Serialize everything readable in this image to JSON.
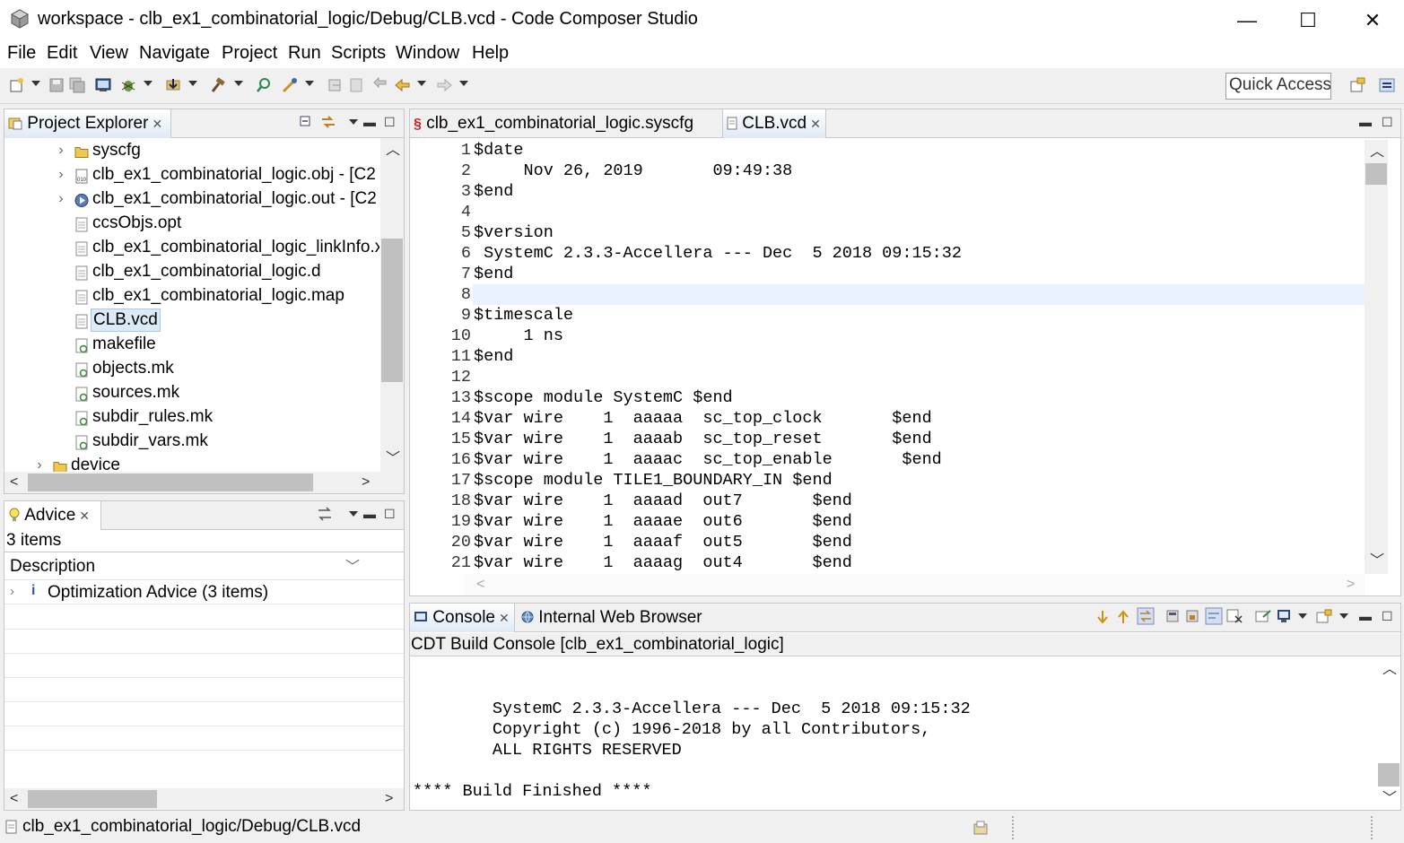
{
  "window": {
    "title": "workspace - clb_ex1_combinatorial_logic/Debug/CLB.vcd - Code Composer Studio",
    "minimize": "—",
    "maximize": "☐",
    "close": "✕"
  },
  "menu": [
    "File",
    "Edit",
    "View",
    "Navigate",
    "Project",
    "Run",
    "Scripts",
    "Window",
    "Help"
  ],
  "toolbar": {
    "quick_access_placeholder": "Quick Access"
  },
  "project_explorer": {
    "title": "Project Explorer",
    "items": [
      {
        "label": "syscfg",
        "type": "folder",
        "expandable": true,
        "indent": 1
      },
      {
        "label": "clb_ex1_combinatorial_logic.obj - [C2",
        "type": "obj",
        "expandable": true,
        "indent": 1
      },
      {
        "label": "clb_ex1_combinatorial_logic.out - [C2",
        "type": "out",
        "expandable": true,
        "indent": 1
      },
      {
        "label": "ccsObjs.opt",
        "type": "file",
        "expandable": false,
        "indent": 1
      },
      {
        "label": "clb_ex1_combinatorial_logic_linkInfo.x",
        "type": "file",
        "expandable": false,
        "indent": 1
      },
      {
        "label": "clb_ex1_combinatorial_logic.d",
        "type": "file",
        "expandable": false,
        "indent": 1
      },
      {
        "label": "clb_ex1_combinatorial_logic.map",
        "type": "file",
        "expandable": false,
        "indent": 1
      },
      {
        "label": "CLB.vcd",
        "type": "file",
        "expandable": false,
        "indent": 1,
        "selected": true
      },
      {
        "label": "makefile",
        "type": "mk",
        "expandable": false,
        "indent": 1
      },
      {
        "label": "objects.mk",
        "type": "mk",
        "expandable": false,
        "indent": 1
      },
      {
        "label": "sources.mk",
        "type": "mk",
        "expandable": false,
        "indent": 1
      },
      {
        "label": "subdir_rules.mk",
        "type": "mk",
        "expandable": false,
        "indent": 1
      },
      {
        "label": "subdir_vars.mk",
        "type": "mk",
        "expandable": false,
        "indent": 1
      },
      {
        "label": "device",
        "type": "folder",
        "expandable": true,
        "indent": 0
      }
    ]
  },
  "advice": {
    "title": "Advice",
    "count": "3 items",
    "column": "Description",
    "row": "Optimization Advice (3 items)"
  },
  "editor": {
    "tabs": [
      {
        "label": "clb_ex1_combinatorial_logic.syscfg",
        "active": false
      },
      {
        "label": "CLB.vcd",
        "active": true
      }
    ],
    "lines": [
      "$date",
      "     Nov 26, 2019       09:49:38",
      "$end",
      "",
      "$version",
      " SystemC 2.3.3-Accellera --- Dec  5 2018 09:15:32",
      "$end",
      "",
      "$timescale",
      "     1 ns",
      "$end",
      "",
      "$scope module SystemC $end",
      "$var wire    1  aaaaa  sc_top_clock       $end",
      "$var wire    1  aaaab  sc_top_reset       $end",
      "$var wire    1  aaaac  sc_top_enable       $end",
      "$scope module TILE1_BOUNDARY_IN $end",
      "$var wire    1  aaaad  out7       $end",
      "$var wire    1  aaaae  out6       $end",
      "$var wire    1  aaaaf  out5       $end",
      "$var wire    1  aaaag  out4       $end"
    ],
    "current_line": 8
  },
  "console": {
    "tabs": [
      {
        "label": "Console",
        "active": true
      },
      {
        "label": "Internal Web Browser",
        "active": false
      }
    ],
    "header": "CDT Build Console [clb_ex1_combinatorial_logic]",
    "lines": [
      "",
      "",
      "        SystemC 2.3.3-Accellera --- Dec  5 2018 09:15:32",
      "        Copyright (c) 1996-2018 by all Contributors,",
      "        ALL RIGHTS RESERVED",
      "",
      "**** Build Finished ****"
    ]
  },
  "statusbar": {
    "path": "clb_ex1_combinatorial_logic/Debug/CLB.vcd"
  }
}
